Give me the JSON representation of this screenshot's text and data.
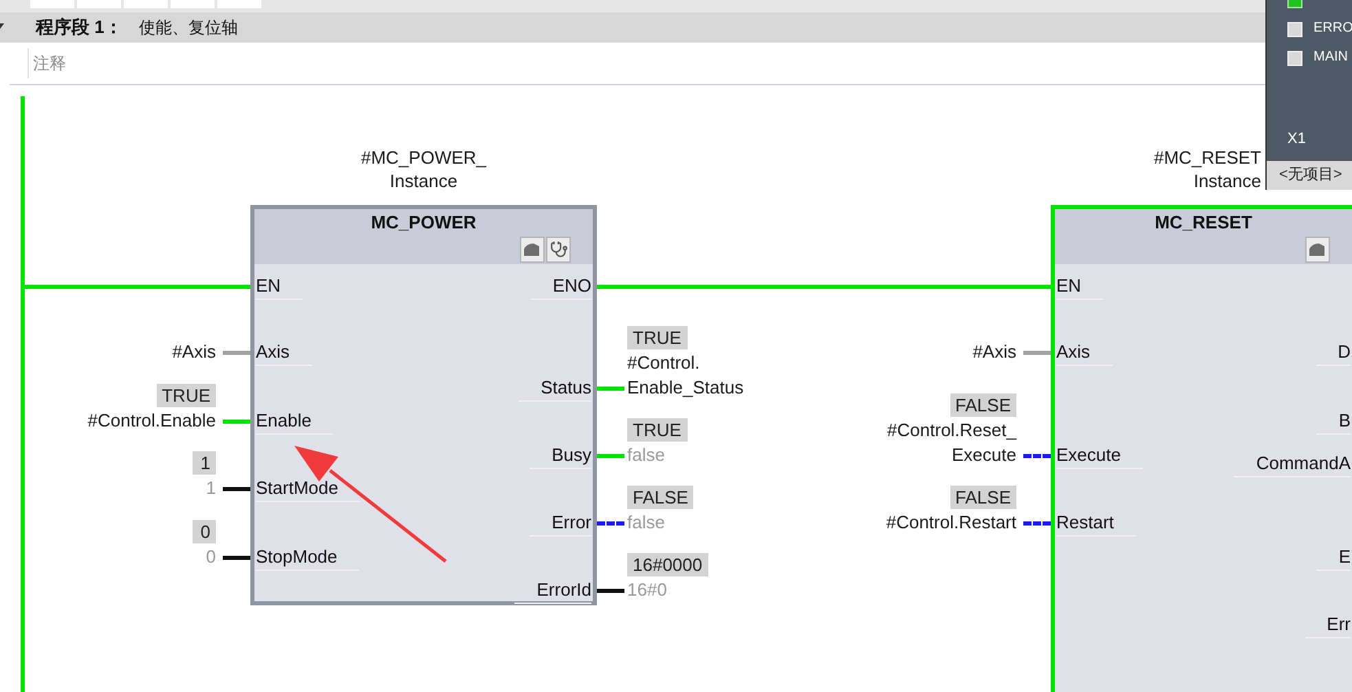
{
  "network": {
    "title": "程序段 1：",
    "description": "使能、复位轴",
    "comment_placeholder": "注释"
  },
  "blocks": [
    {
      "instance": [
        "#MC_POWER_",
        "Instance"
      ],
      "name": "MC_POWER",
      "highlighted": false,
      "icons": [
        {
          "kind": "block"
        },
        {
          "kind": "stethoscope"
        }
      ],
      "inputs": [
        {
          "pin": "EN",
          "kind": "power"
        },
        {
          "pin": "Axis",
          "kind": "reference",
          "operand": [
            "#Axis"
          ]
        },
        {
          "pin": "Enable",
          "kind": "power",
          "status": "TRUE",
          "operand": [
            "#Control.Enable"
          ]
        },
        {
          "pin": "StartMode",
          "kind": "value",
          "status": "1",
          "value": "1"
        },
        {
          "pin": "StopMode",
          "kind": "value",
          "status": "0",
          "value": "0"
        }
      ],
      "outputs": [
        {
          "pin": "ENO",
          "kind": "power"
        },
        {
          "pin": "Status",
          "kind": "power",
          "status": "TRUE",
          "operand": [
            "#Control.",
            "Enable_Status"
          ]
        },
        {
          "pin": "Busy",
          "kind": "power",
          "status": "TRUE",
          "value": "false"
        },
        {
          "pin": "Error",
          "kind": "false",
          "status": "FALSE",
          "value": "false"
        },
        {
          "pin": "ErrorId",
          "kind": "value",
          "status": "16#0000",
          "value": "16#0"
        }
      ]
    },
    {
      "instance": [
        "#MC_RESET",
        "Instance"
      ],
      "name": "MC_RESET",
      "highlighted": true,
      "icons": [
        {
          "kind": "block"
        }
      ],
      "inputs": [
        {
          "pin": "EN",
          "kind": "power"
        },
        {
          "pin": "Axis",
          "kind": "reference",
          "operand": [
            "#Axis"
          ]
        },
        {
          "pin": "Execute",
          "kind": "false",
          "status": "FALSE",
          "operand": [
            "#Control.Reset_",
            "Execute"
          ]
        },
        {
          "pin": "Restart",
          "kind": "false",
          "status": "FALSE",
          "operand": [
            "#Control.Restart"
          ]
        }
      ],
      "outputs": [
        {
          "pin": "D"
        },
        {
          "pin": "B"
        },
        {
          "pin": "CommandA"
        },
        {
          "pin": "E"
        },
        {
          "pin": "Err"
        }
      ]
    }
  ],
  "annotation": {
    "kind": "arrow"
  },
  "side_panel": {
    "items": [
      {
        "checked": true
      },
      {
        "label": "ERRO",
        "checked": false
      },
      {
        "label": "MAIN",
        "checked": false
      }
    ],
    "title": "X1",
    "footer": "<无项目>"
  }
}
